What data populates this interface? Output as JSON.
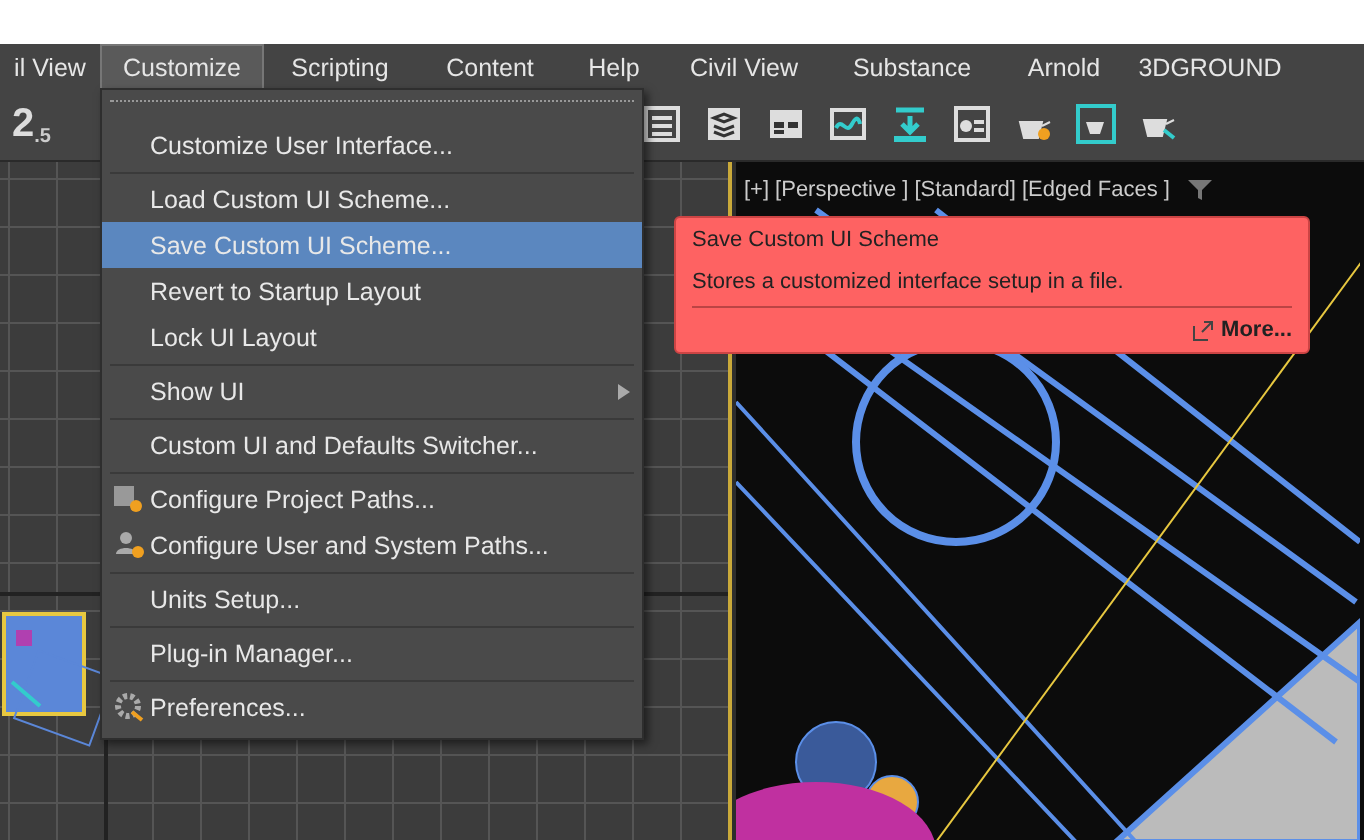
{
  "menubar": {
    "items": [
      {
        "label": "il View",
        "selected": false
      },
      {
        "label": "Customize",
        "selected": true
      },
      {
        "label": "Scripting",
        "selected": false
      },
      {
        "label": "Content",
        "selected": false
      },
      {
        "label": "Help",
        "selected": false
      },
      {
        "label": "Civil View",
        "selected": false
      },
      {
        "label": "Substance",
        "selected": false
      },
      {
        "label": "Arnold",
        "selected": false
      },
      {
        "label": "3DGROUND",
        "selected": false
      }
    ]
  },
  "toolbar": {
    "snap": {
      "label": "2",
      "sub": ".5"
    }
  },
  "menu": {
    "groups": [
      [
        {
          "label": "Customize User Interface...",
          "kind": "plain",
          "selected": false
        }
      ],
      [
        {
          "label": "Load Custom UI Scheme...",
          "kind": "plain",
          "selected": false
        },
        {
          "label": "Save Custom UI Scheme...",
          "kind": "plain",
          "selected": true
        },
        {
          "label": "Revert to Startup Layout",
          "kind": "plain",
          "selected": false
        },
        {
          "label": "Lock UI Layout",
          "kind": "plain",
          "selected": false
        }
      ],
      [
        {
          "label": "Show UI",
          "kind": "submenu",
          "selected": false
        }
      ],
      [
        {
          "label": "Custom UI and Defaults Switcher...",
          "kind": "plain",
          "selected": false
        }
      ],
      [
        {
          "label": "Configure Project Paths...",
          "kind": "folder",
          "selected": false
        },
        {
          "label": "Configure User and System Paths...",
          "kind": "user",
          "selected": false
        }
      ],
      [
        {
          "label": "Units Setup...",
          "kind": "plain",
          "selected": false
        }
      ],
      [
        {
          "label": "Plug-in Manager...",
          "kind": "plain",
          "selected": false
        }
      ],
      [
        {
          "label": "Preferences...",
          "kind": "gear",
          "selected": false
        }
      ]
    ]
  },
  "tooltip": {
    "title": "Save Custom UI Scheme",
    "description": "Stores a customized interface setup in a file.",
    "link": "More..."
  },
  "viewport": {
    "labels": [
      "[+]",
      "[Perspective ]",
      "[Standard]",
      "[Edged Faces ]"
    ]
  }
}
